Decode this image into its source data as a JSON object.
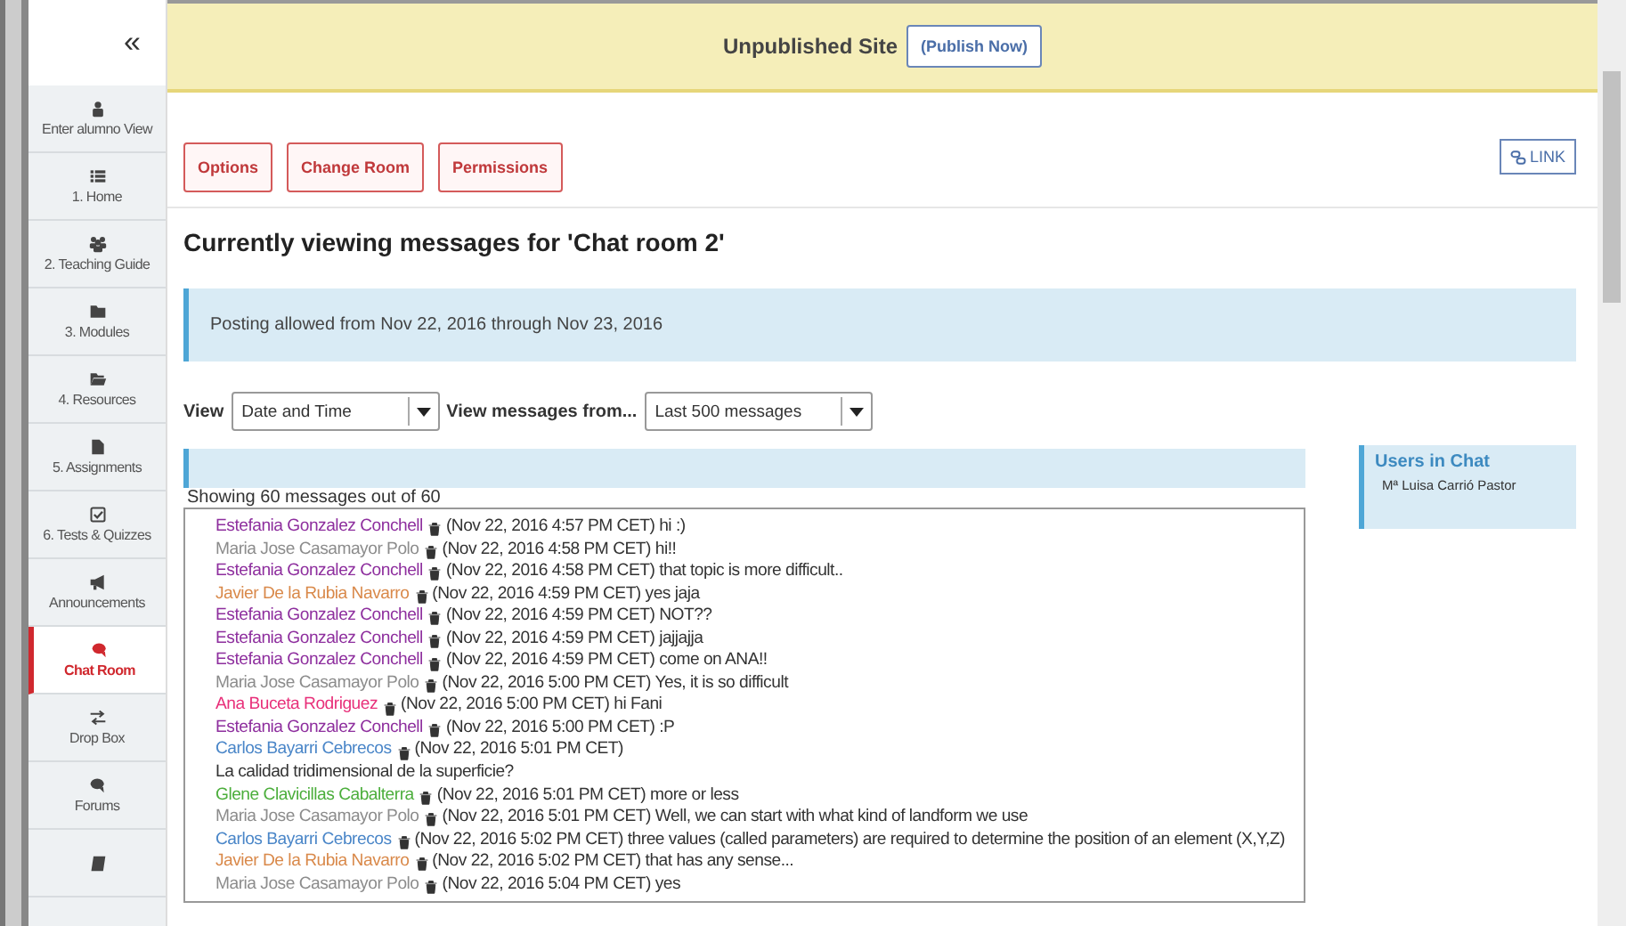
{
  "sidebar": {
    "collapse": "«",
    "items": [
      {
        "label": "Enter alumno View",
        "selected": false
      },
      {
        "label": "1. Home",
        "selected": false
      },
      {
        "label": "2. Teaching Guide",
        "selected": false
      },
      {
        "label": "3. Modules",
        "selected": false
      },
      {
        "label": "4. Resources",
        "selected": false
      },
      {
        "label": "5. Assignments",
        "selected": false
      },
      {
        "label": "6. Tests & Quizzes",
        "selected": false
      },
      {
        "label": "Announcements",
        "selected": false
      },
      {
        "label": "Chat Room",
        "selected": true
      },
      {
        "label": "Drop Box",
        "selected": false
      },
      {
        "label": "Forums",
        "selected": false
      },
      {
        "selected": false
      }
    ]
  },
  "banner": {
    "text": "Unpublished Site",
    "button": "(Publish Now)"
  },
  "toolbar": {
    "buttons": [
      "Options",
      "Change Room",
      "Permissions"
    ],
    "link": "LINK"
  },
  "heading": "Currently viewing messages for 'Chat room 2'",
  "notice": "Posting allowed from Nov 22, 2016 through Nov 23, 2016",
  "filters": {
    "view_label": "View",
    "view_value": "Date and Time",
    "from_label": "View messages from...",
    "from_value": "Last 500 messages"
  },
  "count": "Showing 60 messages out of 60",
  "messages": [
    {
      "kind": "message",
      "author": "Estefania Gonzalez Conchell",
      "color": "#8e2f9e",
      "text": "(Nov 22, 2016 4:57 PM CET) hi :)"
    },
    {
      "kind": "message",
      "author": "Maria Jose Casamayor Polo",
      "color": "#8c8c8c",
      "text": "(Nov 22, 2016 4:58 PM CET) hi!!"
    },
    {
      "kind": "message",
      "author": "Estefania Gonzalez Conchell",
      "color": "#8e2f9e",
      "text": "(Nov 22, 2016 4:58 PM CET) that topic is more difficult.."
    },
    {
      "kind": "message",
      "author": "Javier De la Rubia Navarro",
      "color": "#d9894a",
      "text": "(Nov 22, 2016 4:59 PM CET) yes jaja"
    },
    {
      "kind": "message",
      "author": "Estefania Gonzalez Conchell",
      "color": "#8e2f9e",
      "text": "(Nov 22, 2016 4:59 PM CET) NOT??"
    },
    {
      "kind": "message",
      "author": "Estefania Gonzalez Conchell",
      "color": "#8e2f9e",
      "text": "(Nov 22, 2016 4:59 PM CET) jajjajja"
    },
    {
      "kind": "message",
      "author": "Estefania Gonzalez Conchell",
      "color": "#8e2f9e",
      "text": "(Nov 22, 2016 4:59 PM CET) come on ANA!!"
    },
    {
      "kind": "message",
      "author": "Maria Jose Casamayor Polo",
      "color": "#8c8c8c",
      "text": "(Nov 22, 2016 5:00 PM CET) Yes, it is so difficult"
    },
    {
      "kind": "message",
      "author": "Ana Buceta Rodriguez",
      "color": "#e8307a",
      "text": "(Nov 22, 2016 5:00 PM CET) hi Fani"
    },
    {
      "kind": "message",
      "author": "Estefania Gonzalez Conchell",
      "color": "#8e2f9e",
      "text": "(Nov 22, 2016 5:00 PM CET) :P"
    },
    {
      "kind": "message",
      "author": "Carlos Bayarri Cebrecos",
      "color": "#4a86c8",
      "text": "(Nov 22, 2016 5:01 PM CET)"
    },
    {
      "kind": "continuation",
      "text": "La calidad tridimensional de la superficie?"
    },
    {
      "kind": "message",
      "author": "Glene Clavicillas Cabalterra",
      "color": "#4cae3c",
      "text": "(Nov 22, 2016 5:01 PM CET) more or less"
    },
    {
      "kind": "message",
      "author": "Maria Jose Casamayor Polo",
      "color": "#8c8c8c",
      "text": "(Nov 22, 2016 5:01 PM CET) Well, we can start with what kind of landform we use"
    },
    {
      "kind": "message",
      "author": "Carlos Bayarri Cebrecos",
      "color": "#4a86c8",
      "text": "(Nov 22, 2016 5:02 PM CET) three values (called parameters) are required to determine the position of an element (X,Y,Z)"
    },
    {
      "kind": "message",
      "author": "Javier De la Rubia Navarro",
      "color": "#d9894a",
      "text": "(Nov 22, 2016 5:02 PM CET) that has any sense..."
    },
    {
      "kind": "message",
      "author": "Maria Jose Casamayor Polo",
      "color": "#8c8c8c",
      "text": "(Nov 22, 2016 5:04 PM CET) yes"
    }
  ],
  "users": {
    "title": "Users in Chat",
    "names": [
      "Mª Luisa Carrió Pastor"
    ]
  }
}
